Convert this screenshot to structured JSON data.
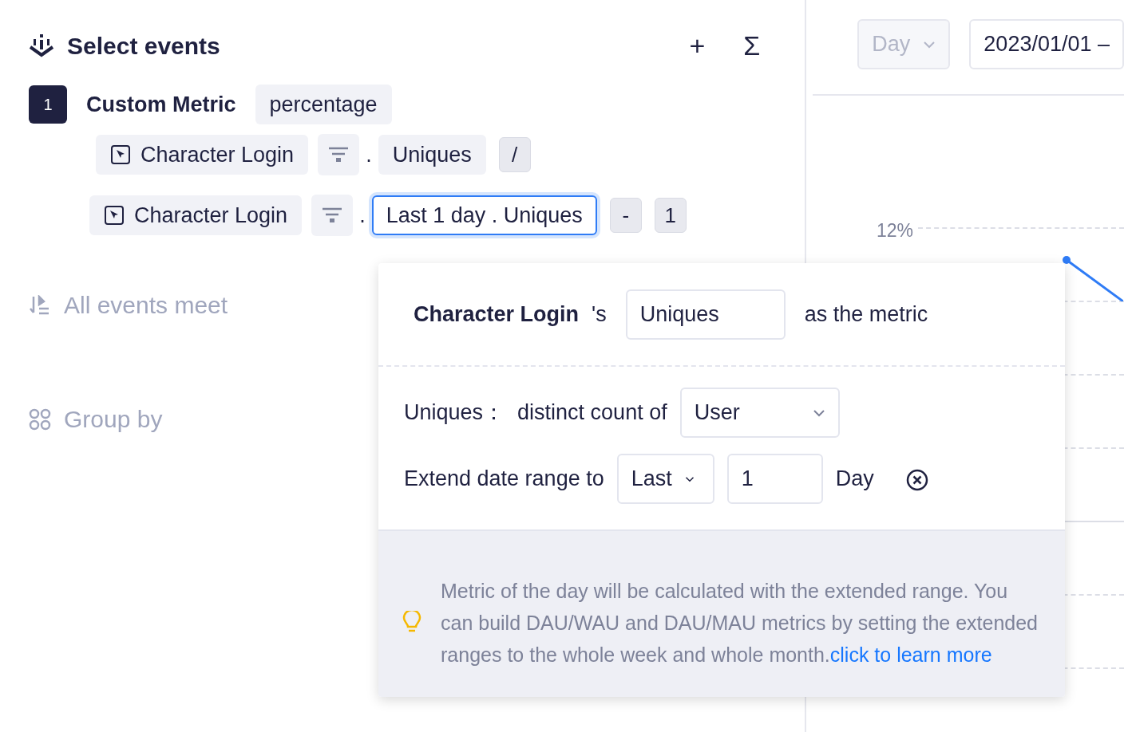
{
  "header": {
    "title": "Select events",
    "actions": [
      "+",
      "Σ"
    ]
  },
  "metric": {
    "index": "1",
    "name": "Custom Metric",
    "format": "percentage"
  },
  "formula_rows": [
    {
      "event": "Character Login",
      "separator": ".",
      "measure": "Uniques",
      "active": false,
      "operators": [
        "/"
      ]
    },
    {
      "event": "Character Login",
      "separator": ".",
      "measure": "Last 1 day . Uniques",
      "active": true,
      "operators": [
        "-",
        "1"
      ]
    }
  ],
  "sections": [
    {
      "label": "All events meet",
      "kind": "filter"
    },
    {
      "label": "Group by",
      "kind": "group"
    }
  ],
  "toolbar": {
    "granularity": {
      "value": "Day",
      "disabled": true
    },
    "date_range": "2023/01/01 –"
  },
  "chart": {
    "y_label": "12%"
  },
  "popover": {
    "event": "Character Login",
    "possessive": "'s",
    "measure": "Uniques",
    "suffix": "as the metric",
    "count_label": "Uniques：",
    "count_text": "distinct count of",
    "count_by": "User",
    "extend_label": "Extend date range to",
    "extend_mode": "Last",
    "extend_value": "1",
    "extend_unit": "Day",
    "tip": "Metric of the day will be calculated with the extended range. You can build DAU/WAU and DAU/MAU metrics by setting the extended ranges to the whole week and whole month.",
    "tip_link": "click to learn more"
  }
}
